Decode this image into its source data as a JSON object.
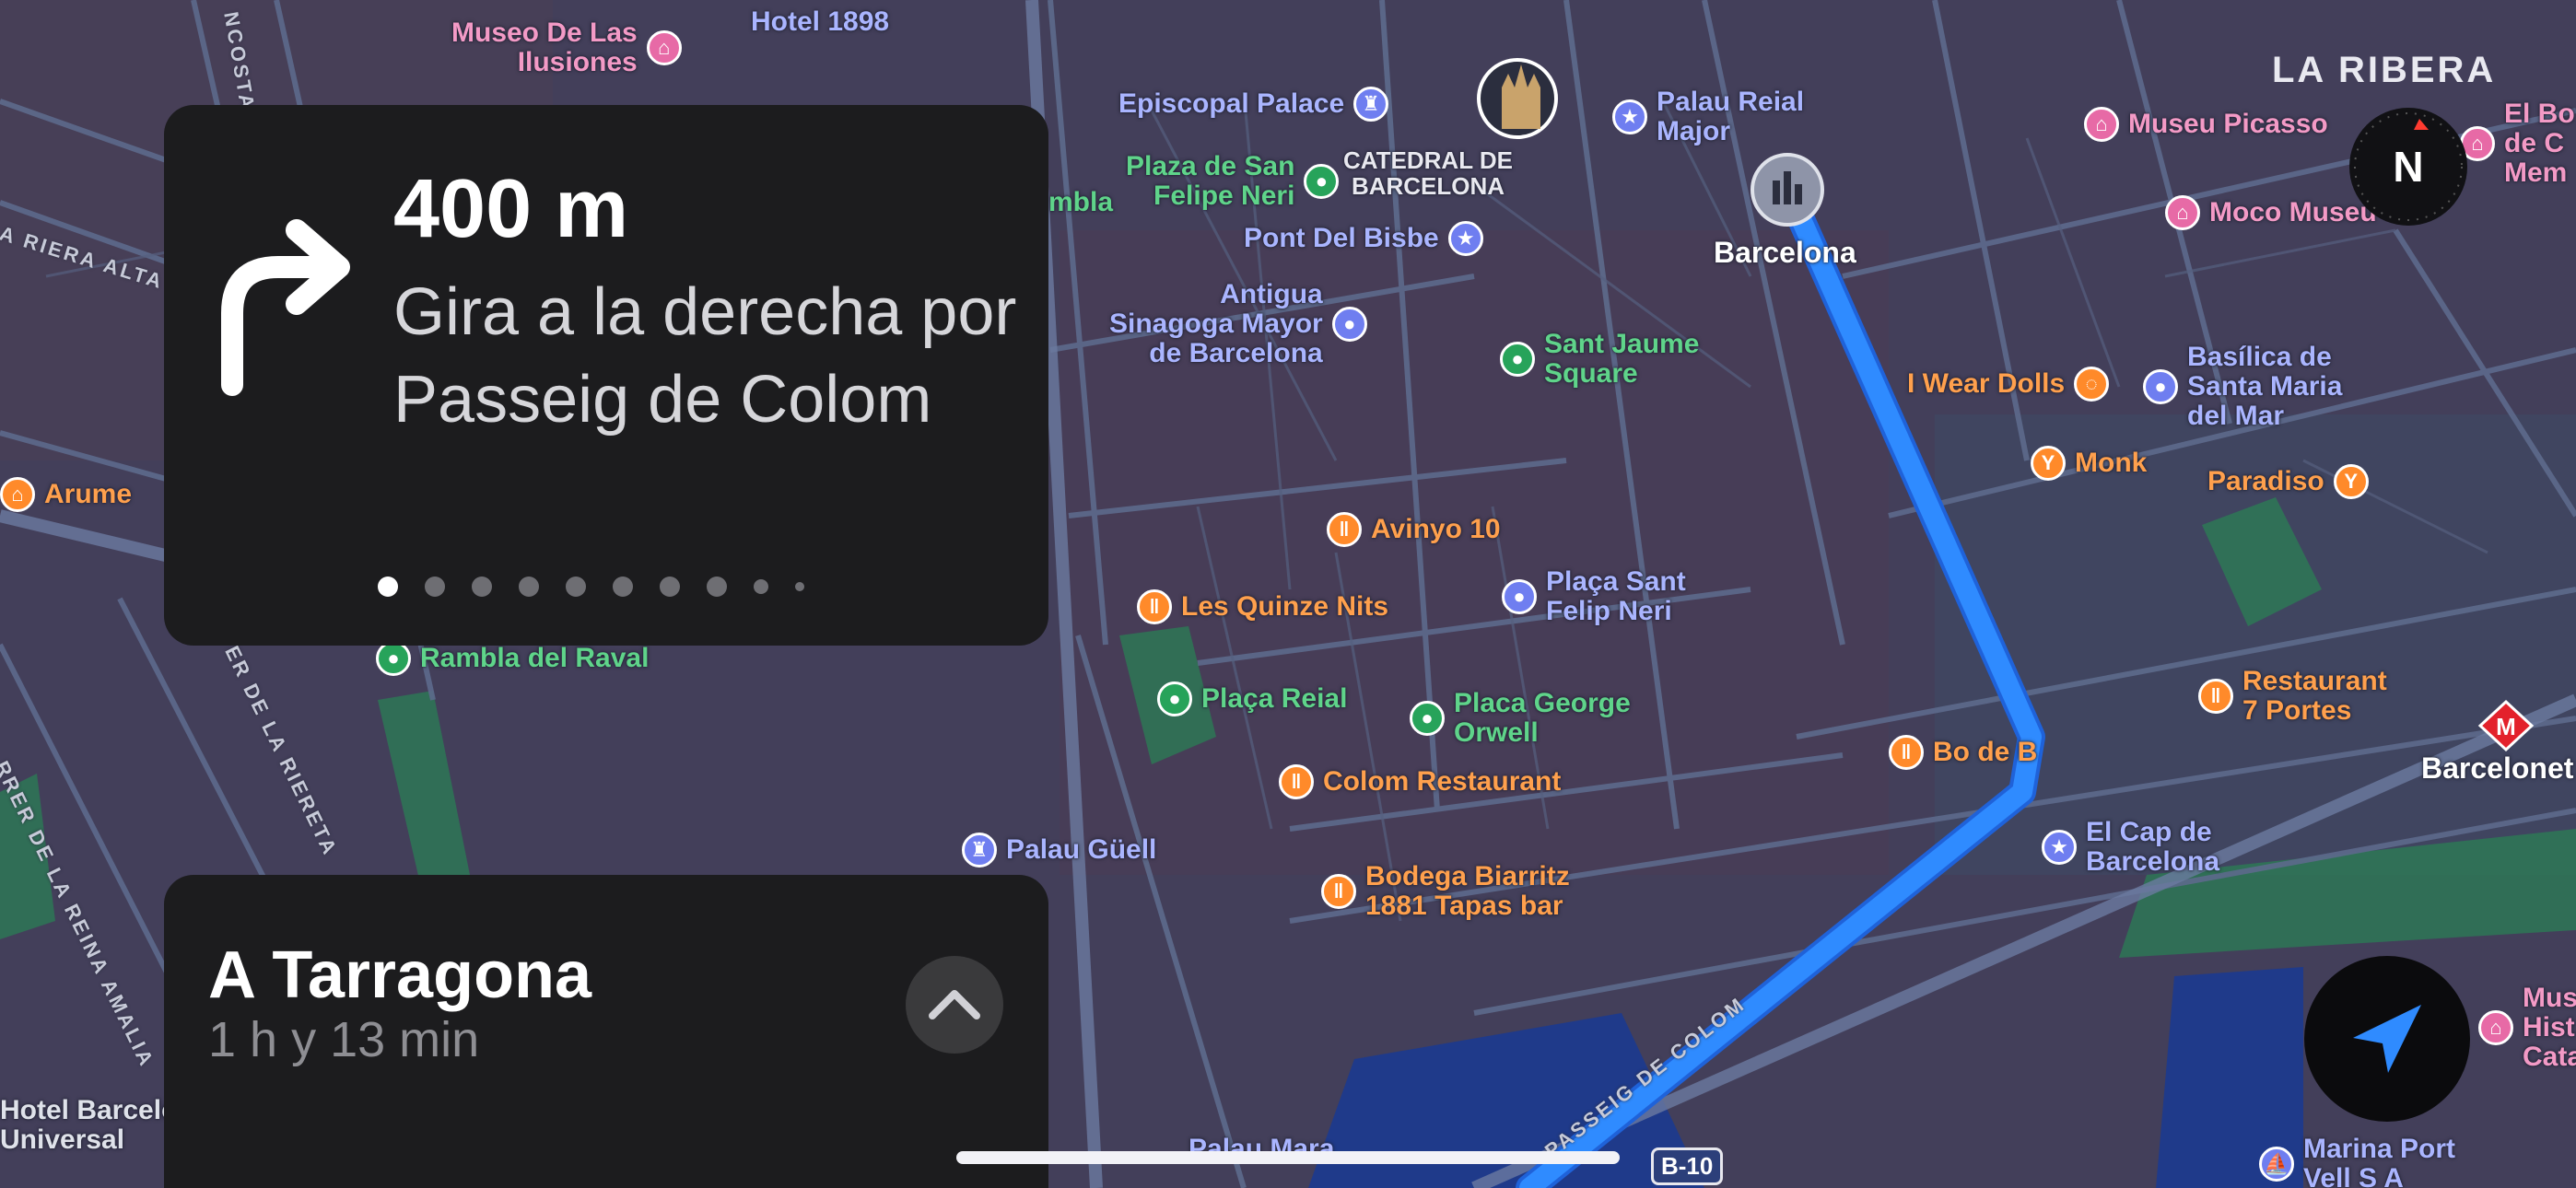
{
  "colors": {
    "route": "#2f8bff",
    "route_outline": "#1f62d9",
    "food": "#ff8a2a",
    "food_label": "#ffa04d",
    "park": "#27a35a",
    "park_label": "#5fd48a",
    "landmark": "#6f7ef0",
    "landmark_label": "#aab5ff",
    "museum": "#e76aa6",
    "museum_label": "#f39ac6",
    "metro": "#e3212b"
  },
  "navigation": {
    "distance": "400 m",
    "instruction": "Gira a la derecha por Passeig de Colom",
    "maneuver_icon": "turn-right-arrow-icon",
    "step_count": 10,
    "active_step": 0
  },
  "trip": {
    "destination": "A Tarragona",
    "eta": "1 h y 13 min",
    "expand_icon": "chevron-up-icon"
  },
  "compass": {
    "label": "N"
  },
  "map": {
    "district": "LA RIBERA",
    "route_shield": "B-10",
    "streets": [
      {
        "id": "passeig-colom",
        "label": "PASSEIG DE COLOM"
      },
      {
        "id": "riera-alta",
        "label": "A RIERA ALTA"
      },
      {
        "id": "riereta",
        "label": "ER DE LA RIERETA"
      },
      {
        "id": "reina-amalia",
        "label": "RRER DE LA REINA AMALIA"
      },
      {
        "id": "costa",
        "label": "NCOSTA"
      }
    ],
    "pois": [
      {
        "id": "museo-ilusiones",
        "label": "Museo De Las\nIlusiones",
        "kind": "museum",
        "icon": "museum-icon"
      },
      {
        "id": "hotel-1898",
        "label": "Hotel 1898",
        "kind": "landmark",
        "icon": ""
      },
      {
        "id": "episcopal-palace",
        "label": "Episcopal Palace",
        "kind": "landmark",
        "icon": "castle-icon"
      },
      {
        "id": "catedral",
        "label": "CATEDRAL DE\nBARCELONA",
        "kind": "highlight",
        "icon": "cathedral-icon"
      },
      {
        "id": "palau-reial",
        "label": "Palau Reial\nMajor",
        "kind": "landmark",
        "icon": "star-icon"
      },
      {
        "id": "plaza-felipe-neri",
        "label": "Plaza de San\nFelipe Neri",
        "kind": "park",
        "icon": "park-icon"
      },
      {
        "id": "rambla",
        "label": "mbla",
        "kind": "park",
        "icon": ""
      },
      {
        "id": "pont-bisbe",
        "label": "Pont Del Bisbe",
        "kind": "landmark",
        "icon": "star-icon"
      },
      {
        "id": "barcelona",
        "label": "Barcelona",
        "kind": "city",
        "icon": "city-icon"
      },
      {
        "id": "museu-picasso",
        "label": "Museu Picasso",
        "kind": "museum",
        "icon": "museum-icon"
      },
      {
        "id": "moco-museum",
        "label": "Moco Museu",
        "kind": "museum",
        "icon": "museum-icon"
      },
      {
        "id": "el-born",
        "label": "El Bo\nde C\nMem",
        "kind": "museum",
        "icon": "museum-icon"
      },
      {
        "id": "sinagoga",
        "label": "Antigua\nSinagoga Mayor\nde Barcelona",
        "kind": "landmark",
        "icon": "landmark-icon"
      },
      {
        "id": "sant-jaume",
        "label": "Sant Jaume\nSquare",
        "kind": "park",
        "icon": "park-icon"
      },
      {
        "id": "wear-dolls",
        "label": "I Wear Dolls",
        "kind": "food",
        "icon": "ring-icon"
      },
      {
        "id": "santa-maria",
        "label": "Basílica de\nSanta Maria\ndel Mar",
        "kind": "landmark",
        "icon": "landmark-icon"
      },
      {
        "id": "monk",
        "label": "Monk",
        "kind": "food",
        "icon": "cocktail-icon"
      },
      {
        "id": "paradiso",
        "label": "Paradiso",
        "kind": "food",
        "icon": "cocktail-icon"
      },
      {
        "id": "arume",
        "label": "Arume",
        "kind": "food",
        "icon": "museum-icon"
      },
      {
        "id": "avinyo",
        "label": "Avinyo 10",
        "kind": "food",
        "icon": "fork-knife-icon"
      },
      {
        "id": "quinze-nits",
        "label": "Les Quinze Nits",
        "kind": "food",
        "icon": "fork-knife-icon"
      },
      {
        "id": "placa-felip-neri",
        "label": "Plaça Sant\nFelip Neri",
        "kind": "landmark",
        "icon": "landmark-icon"
      },
      {
        "id": "rambla-raval",
        "label": "Rambla del Raval",
        "kind": "park",
        "icon": "park-icon"
      },
      {
        "id": "placa-reial",
        "label": "Plaça Reial",
        "kind": "park",
        "icon": "park-icon"
      },
      {
        "id": "placa-orwell",
        "label": "Placa George\nOrwell",
        "kind": "park",
        "icon": "park-icon"
      },
      {
        "id": "restaurant-7-portes",
        "label": "Restaurant\n7 Portes",
        "kind": "food",
        "icon": "fork-knife-icon"
      },
      {
        "id": "bo-de-b",
        "label": "Bo de B",
        "kind": "food",
        "icon": "fork-knife-icon"
      },
      {
        "id": "barceloneta",
        "label": "Barcelonet",
        "kind": "metro",
        "icon": "metro-icon"
      },
      {
        "id": "colom-restaurant",
        "label": "Colom Restaurant",
        "kind": "food",
        "icon": "fork-knife-icon"
      },
      {
        "id": "palau-guell",
        "label": "Palau Güell",
        "kind": "landmark",
        "icon": "castle-icon"
      },
      {
        "id": "cap-barcelona",
        "label": "El Cap de\nBarcelona",
        "kind": "landmark",
        "icon": "star-icon"
      },
      {
        "id": "bodega-biarritz",
        "label": "Bodega Biarritz\n1881 Tapas bar",
        "kind": "food",
        "icon": "fork-knife-icon"
      },
      {
        "id": "museu-historia",
        "label": "Mus\nHist\nCata",
        "kind": "museum",
        "icon": "museum-icon"
      },
      {
        "id": "hotel-universal",
        "label": "Hotel Barcelo\nUniversal",
        "kind": "hotel",
        "icon": "bed-icon"
      },
      {
        "id": "palau-mar",
        "label": "Palau Mara",
        "kind": "landmark",
        "icon": ""
      },
      {
        "id": "marina-port",
        "label": "Marina Port\nVell S A",
        "kind": "landmark",
        "icon": "sailboat-icon"
      }
    ]
  }
}
